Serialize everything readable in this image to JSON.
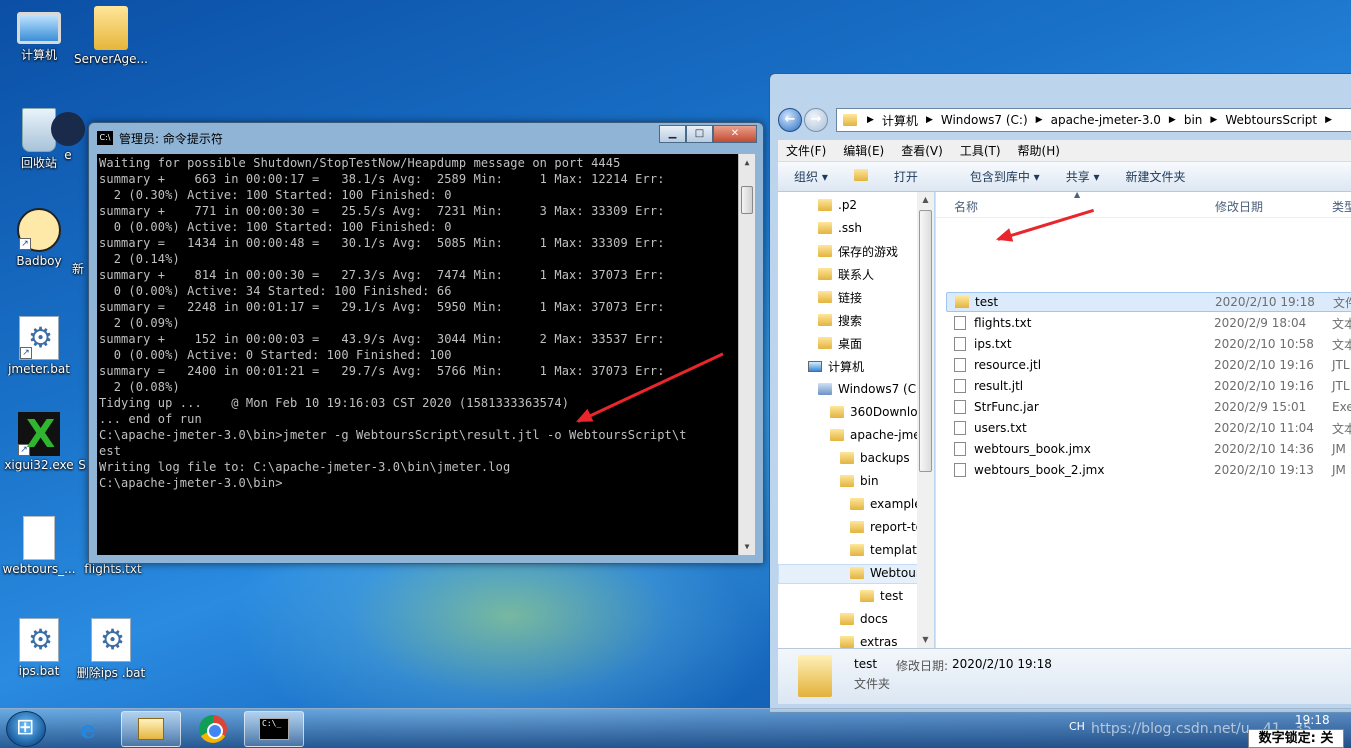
{
  "desktop": {
    "icons": [
      {
        "label": "计算机"
      },
      {
        "label": "ServerAge..."
      },
      {
        "label": "回收站"
      },
      {
        "label": "e"
      },
      {
        "label": "Badboy"
      },
      {
        "label": "新"
      },
      {
        "label": "jmeter.bat"
      },
      {
        "label": "xigui32.exe"
      },
      {
        "label": "S"
      },
      {
        "label": "webtours_..."
      },
      {
        "label": "flights.txt"
      },
      {
        "label": "ips.bat"
      },
      {
        "label": "删除ips .bat"
      }
    ]
  },
  "cmd": {
    "title": "管理员: 命令提示符",
    "icon_text": "C:\\",
    "buttons": {
      "minimize": "▁",
      "maximize": "□",
      "close": "✕"
    },
    "lines": [
      "Waiting for possible Shutdown/StopTestNow/Heapdump message on port 4445",
      "summary +    663 in 00:00:17 =   38.1/s Avg:  2589 Min:     1 Max: 12214 Err:",
      "  2 (0.30%) Active: 100 Started: 100 Finished: 0",
      "summary +    771 in 00:00:30 =   25.5/s Avg:  7231 Min:     3 Max: 33309 Err:",
      "  0 (0.00%) Active: 100 Started: 100 Finished: 0",
      "summary =   1434 in 00:00:48 =   30.1/s Avg:  5085 Min:     1 Max: 33309 Err:",
      "  2 (0.14%)",
      "summary +    814 in 00:00:30 =   27.3/s Avg:  7474 Min:     1 Max: 37073 Err:",
      "  0 (0.00%) Active: 34 Started: 100 Finished: 66",
      "summary =   2248 in 00:01:17 =   29.1/s Avg:  5950 Min:     1 Max: 37073 Err:",
      "  2 (0.09%)",
      "summary +    152 in 00:00:03 =   43.9/s Avg:  3044 Min:     2 Max: 33537 Err:",
      "  0 (0.00%) Active: 0 Started: 100 Finished: 100",
      "summary =   2400 in 00:01:21 =   29.7/s Avg:  5766 Min:     1 Max: 37073 Err:",
      "  2 (0.08%)",
      "Tidying up ...    @ Mon Feb 10 19:16:03 CST 2020 (1581333363574)",
      "... end of run",
      "C:\\apache-jmeter-3.0\\bin>jmeter -g WebtoursScript\\result.jtl -o WebtoursScript\\t",
      "est",
      "Writing log file to: C:\\apache-jmeter-3.0\\bin\\jmeter.log",
      "C:\\apache-jmeter-3.0\\bin>"
    ]
  },
  "explorer": {
    "breadcrumb": [
      "计算机",
      "Windows7 (C:)",
      "apache-jmeter-3.0",
      "bin",
      "WebtoursScript"
    ],
    "menu": [
      "文件(F)",
      "编辑(E)",
      "查看(V)",
      "工具(T)",
      "帮助(H)"
    ],
    "toolbar": [
      "组织 ▾",
      "打开",
      "包含到库中 ▾",
      "共享 ▾",
      "新建文件夹"
    ],
    "tree": [
      {
        "label": ".p2",
        "indent": 1
      },
      {
        "label": ".ssh",
        "indent": 1
      },
      {
        "label": "保存的游戏",
        "indent": 1
      },
      {
        "label": "联系人",
        "indent": 1
      },
      {
        "label": "链接",
        "indent": 1
      },
      {
        "label": "搜索",
        "indent": 1
      },
      {
        "label": "桌面",
        "indent": 1
      },
      {
        "label": "计算机",
        "indent": 0
      },
      {
        "label": "Windows7 (C:",
        "indent": 1
      },
      {
        "label": "360Downloa",
        "indent": 2
      },
      {
        "label": "apache-jme",
        "indent": 2
      },
      {
        "label": "backups",
        "indent": 3
      },
      {
        "label": "bin",
        "indent": 3
      },
      {
        "label": "example",
        "indent": 4
      },
      {
        "label": "report-te",
        "indent": 4
      },
      {
        "label": "template",
        "indent": 4
      },
      {
        "label": "Webtour",
        "indent": 4
      },
      {
        "label": "test",
        "indent": 5
      },
      {
        "label": "docs",
        "indent": 3
      },
      {
        "label": "extras",
        "indent": 3
      }
    ],
    "columns": {
      "name": "名称",
      "date": "修改日期",
      "type": "类型"
    },
    "files": [
      {
        "name": "test",
        "date": "2020/2/10 19:18",
        "type": "文件",
        "icon": "folder"
      },
      {
        "name": "flights.txt",
        "date": "2020/2/9 18:04",
        "type": "文本",
        "icon": "file"
      },
      {
        "name": "ips.txt",
        "date": "2020/2/10 10:58",
        "type": "文本",
        "icon": "file"
      },
      {
        "name": "resource.jtl",
        "date": "2020/2/10 19:16",
        "type": "JTL",
        "icon": "file"
      },
      {
        "name": "result.jtl",
        "date": "2020/2/10 19:16",
        "type": "JTL",
        "icon": "file"
      },
      {
        "name": "StrFunc.jar",
        "date": "2020/2/9 15:01",
        "type": "Exe",
        "icon": "file"
      },
      {
        "name": "users.txt",
        "date": "2020/2/10 11:04",
        "type": "文本",
        "icon": "file"
      },
      {
        "name": "webtours_book.jmx",
        "date": "2020/2/10 14:36",
        "type": "JM",
        "icon": "file"
      },
      {
        "name": "webtours_book_2.jmx",
        "date": "2020/2/10 19:13",
        "type": "JM",
        "icon": "file"
      }
    ],
    "details": {
      "name": "test",
      "date_label": "修改日期:",
      "date_value": "2020/2/10 19:18",
      "type": "文件夹"
    }
  },
  "taskbar": {
    "lang": "CH",
    "watermark": "https://blog.csdn.net/u...41...35",
    "clock": "19:18",
    "numlock": "数字锁定: 关"
  }
}
